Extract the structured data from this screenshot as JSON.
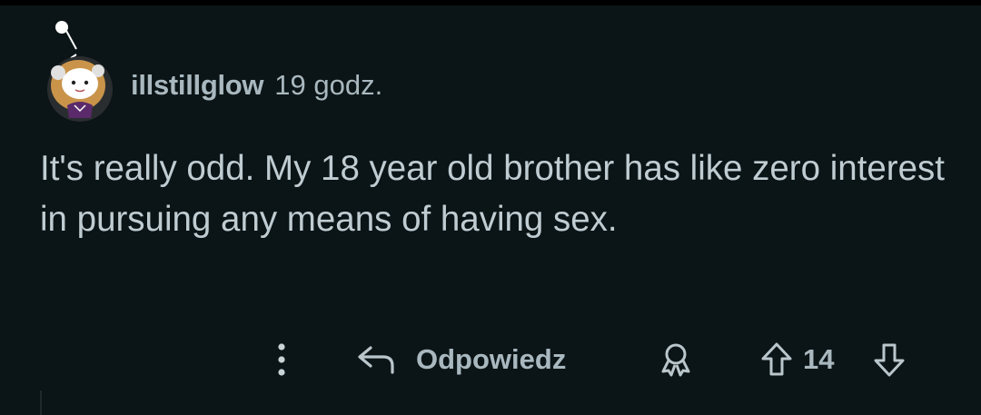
{
  "comment": {
    "username": "illstillglow",
    "timestamp": "19 godz.",
    "body": "It's really odd. My 18 year old brother has like zero interest in pursuing any means of having sex."
  },
  "actions": {
    "reply_label": "Odpowiedz",
    "score": "14"
  },
  "icons": {
    "avatar": "snoo-avatar",
    "more": "more-vertical-icon",
    "reply": "reply-arrow-icon",
    "award": "award-icon",
    "upvote": "upvote-arrow-icon",
    "downvote": "downvote-arrow-icon"
  },
  "colors": {
    "background": "#0b1416",
    "text": "#bfccd2",
    "meta_text": "#a9b8bf"
  }
}
